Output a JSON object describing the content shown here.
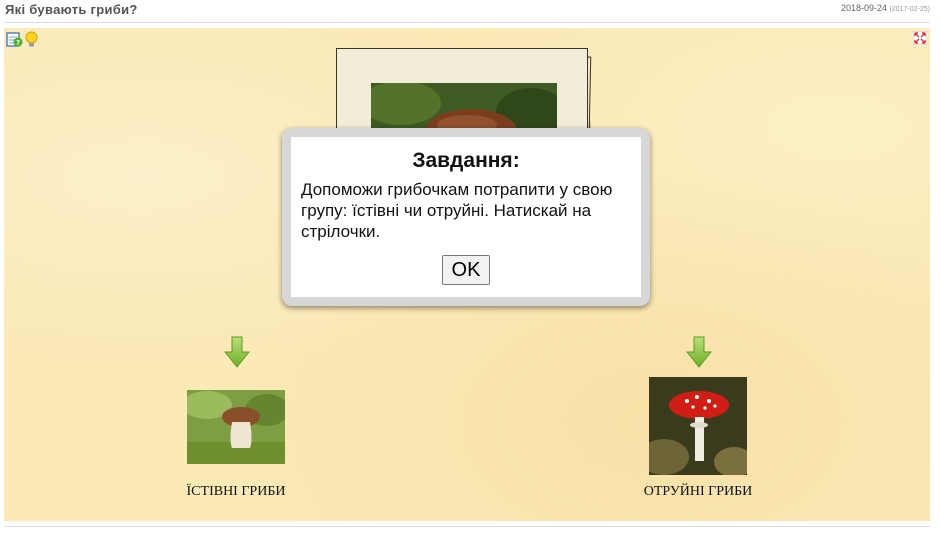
{
  "header": {
    "title": "Які бувають гриби?",
    "date": "2018-09-24",
    "date_secondary": "(2017-02-25)"
  },
  "toolbar": {
    "help_icon": "help-check-icon",
    "hint_icon": "lightbulb-icon",
    "fullscreen_icon": "fullscreen-icon"
  },
  "modal": {
    "title": "Завдання:",
    "text": "Допоможи грибочкам потрапити у свою групу: їстівні чи отруйні. Натискай на стрілочки.",
    "ok_label": "OK"
  },
  "groups": [
    {
      "label": "ЇСТІВНІ ГРИБИ",
      "icon": "arrow-down-icon"
    },
    {
      "label": "ОТРУЙНІ ГРИБИ",
      "icon": "arrow-down-icon"
    }
  ],
  "colors": {
    "stage_background": "#fbe9b6",
    "arrow_green": "#8cc63f",
    "modal_frame": "#d7d7d7"
  }
}
